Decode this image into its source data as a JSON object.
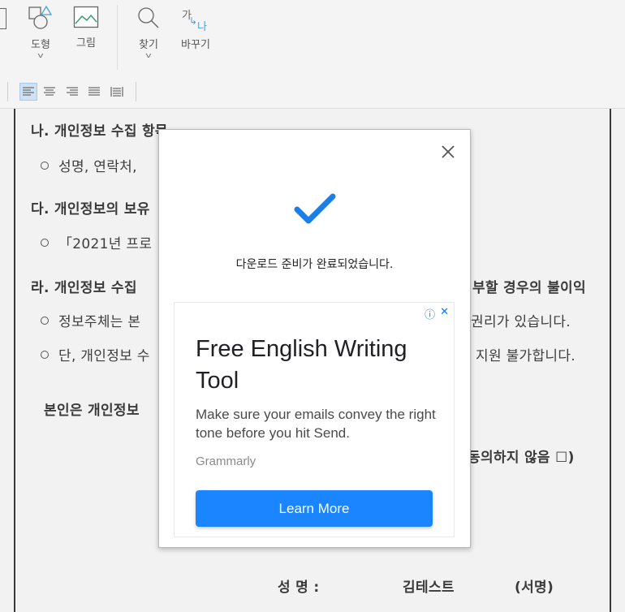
{
  "ribbon": {
    "shape_label": "도형",
    "picture_label": "그림",
    "find_label": "찾기",
    "replace_label": "바꾸기",
    "replace_icon_text": "가",
    "replace_icon_text_2": "나"
  },
  "document": {
    "lines": [
      "나. 개인정보 수집 항목",
      "성명, 연락처,",
      "다. 개인정보의 보유",
      "「2021년 프로",
      "라. 개인정보 수집",
      "거부할 경우의 불이익",
      "정보주체는 본",
      "권리가 있습니다.",
      "단, 개인정보 수",
      "지원 불가합니다.",
      "본인은  개인정보",
      "동의하지 않음 ☐)",
      "성    명   :",
      "김테스트",
      "(서명)"
    ]
  },
  "modal": {
    "message": "다운로드 준비가 완료되었습니다.",
    "ad": {
      "title": "Free English Writing Tool",
      "description": "Make sure your emails convey the right tone before you hit Send.",
      "brand": "Grammarly",
      "cta": "Learn More",
      "info_icon": "ⓘ",
      "close_icon": "✕"
    }
  },
  "colors": {
    "accent": "#1a85ff",
    "check": "#1a7fe8"
  }
}
